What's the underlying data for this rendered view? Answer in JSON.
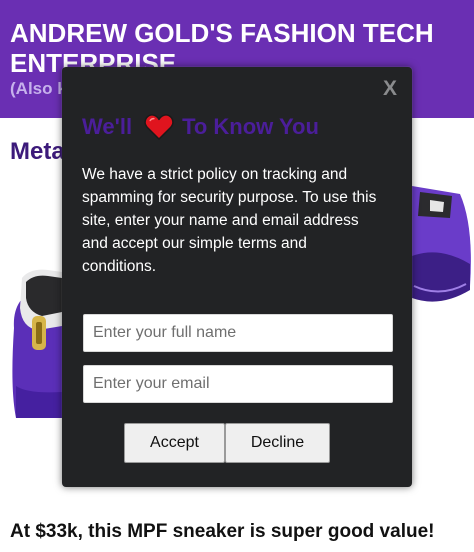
{
  "header": {
    "title": "ANDREW GOLD'S FASHION TECH ENTERPRISE",
    "subtitle": "(Also k"
  },
  "main": {
    "section_heading": "Meta",
    "bottom_text": "At $33k, this MPF sneaker is super good value!"
  },
  "modal": {
    "close_label": "X",
    "title_before": "We'll",
    "title_after": "To Know You",
    "heart_icon": "heart-icon",
    "policy_text": "We have a strict policy on tracking and spamming for security purpose. To use this site, enter your name and email address and accept our simple terms and conditions.",
    "name_placeholder": "Enter your full name",
    "email_placeholder": "Enter your email",
    "accept_label": "Accept",
    "decline_label": "Decline"
  },
  "colors": {
    "header_bg": "#6a2fb3",
    "modal_bg": "#222325",
    "title_color": "#4b1e9a",
    "heart": "#e0141e"
  }
}
